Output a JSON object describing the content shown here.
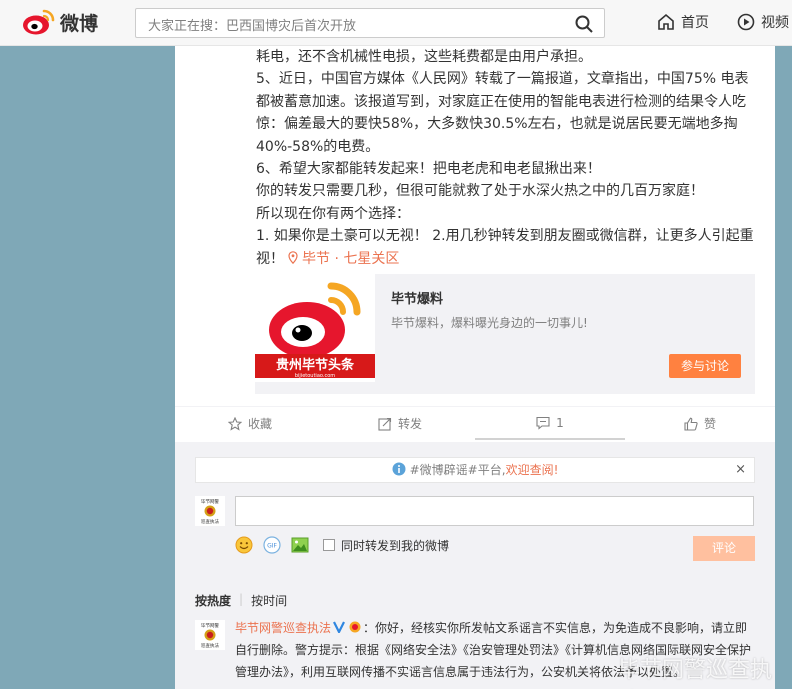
{
  "topbar": {
    "logo_text": "微博",
    "search_placeholder": "大家正在搜：巴西国博灾后首次开放",
    "nav_home": "首页",
    "nav_video": "视频"
  },
  "post": {
    "lines": [
      "耗电，还不含机械性电损，这些耗费都是由用户承担。",
      "5、近日，中国官方媒体《人民网》转载了一篇报道，文章指出，中国75% 电表",
      "都被蓄意加速。该报道写到，对家庭正在使用的智能电表进行检测的结果令人吃",
      "惊：偏差最大的要快58%，大多数快30.5%左右，也就是说居民要无端地多掏",
      "40%-58%的电费。",
      "6、希望大家都能转发起来！把电老虎和电老鼠揪出来！",
      "你的转发只需要几秒，但很可能就救了处于水深火热之中的几百万家庭！",
      "所以现在你有两个选择：",
      "1. 如果你是土豪可以无视！ 2.用几秒钟转发到朋友圈或微信群，让更多人引起重",
      "视！"
    ],
    "location": "毕节 · 七星关区"
  },
  "share_card": {
    "title": "毕节爆料",
    "desc": "毕节爆料，爆料曝光身边的一切事儿!",
    "button": "参与讨论",
    "img_caption": "贵州毕节头条",
    "img_sub": "bijietoutiao.com"
  },
  "actions": {
    "favorite": "收藏",
    "repost": "转发",
    "comment": "1",
    "like": "赞"
  },
  "comment_area": {
    "notice_tag": "#微博辟谣#平台,",
    "notice_hl": "欢迎查阅!",
    "notice_close": "×",
    "avatar_label": "毕节网警\n巡查执法",
    "repost_checkbox_label": "同时转发到我的微博",
    "submit": "评论",
    "sort_hot": "按热度",
    "sort_time": "按时间",
    "comment_user": "毕节网警巡查执法",
    "comment_text": "：你好，经核实你所发帖文系谣言不实信息，为免造成不良影响，请立即自行删除。警方提示：根据《网络安全法》《治安管理处罚法》《计算机信息网络国际联网安全保护管理办法》，利用互联网传播不实谣言信息属于违法行为，公安机关将依法予以处置。"
  },
  "watermark": "毕节网警巡查执法",
  "colors": {
    "accent": "#eb7350",
    "button_orange": "#ff8140",
    "page_bg": "#7fa8b7"
  }
}
